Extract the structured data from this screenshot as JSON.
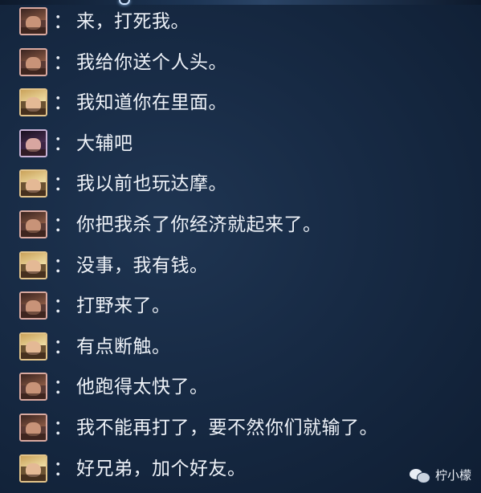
{
  "messages": [
    {
      "avatar": "warrior-red",
      "colon": "：",
      "text": "来，打死我。"
    },
    {
      "avatar": "warrior-red",
      "colon": "：",
      "text": "我给你送个人头。"
    },
    {
      "avatar": "blonde-gold",
      "colon": "：",
      "text": "我知道你在里面。"
    },
    {
      "avatar": "dark-purple",
      "colon": "：",
      "text": "大辅吧"
    },
    {
      "avatar": "blonde-gold",
      "colon": "：",
      "text": "我以前也玩达摩。"
    },
    {
      "avatar": "warrior-red",
      "colon": "：",
      "text": "你把我杀了你经济就起来了。"
    },
    {
      "avatar": "blonde-gold",
      "colon": "：",
      "text": "没事，我有钱。"
    },
    {
      "avatar": "warrior-red",
      "colon": "：",
      "text": "打野来了。"
    },
    {
      "avatar": "blonde-gold",
      "colon": "：",
      "text": "有点断触。"
    },
    {
      "avatar": "warrior-red",
      "colon": "：",
      "text": "他跑得太快了。"
    },
    {
      "avatar": "warrior-red",
      "colon": "：",
      "text": "我不能再打了，要不然你们就输了。"
    },
    {
      "avatar": "blonde-gold",
      "colon": "：",
      "text": "好兄弟，加个好友。"
    }
  ],
  "watermark": {
    "icon": "wechat-icon",
    "text": "柠小檬"
  },
  "colors": {
    "background": "#172a44",
    "text": "#eef2f8"
  }
}
